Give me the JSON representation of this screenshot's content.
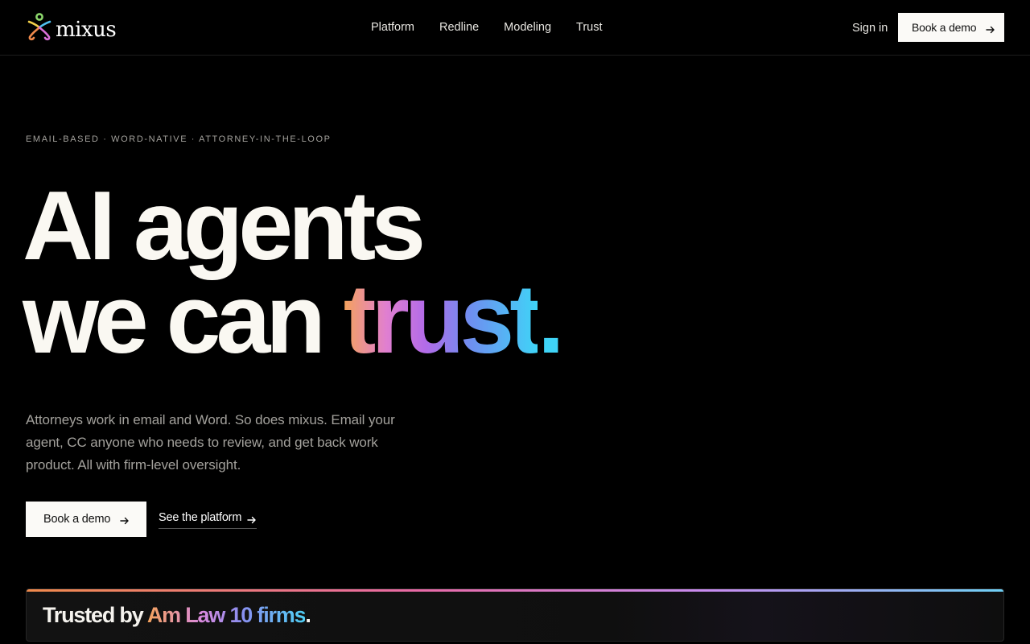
{
  "brand": {
    "name": "mixus"
  },
  "nav": {
    "items": [
      {
        "label": "Platform"
      },
      {
        "label": "Redline"
      },
      {
        "label": "Modeling"
      },
      {
        "label": "Trust"
      }
    ],
    "sign_in": "Sign in",
    "cta": "Book a demo"
  },
  "hero": {
    "eyebrow": "EMAIL-BASED · WORD-NATIVE · ATTORNEY-IN-THE-LOOP",
    "title_line1": "AI agents",
    "title_line2_prefix": "we can",
    "title_line2_highlight": "trust",
    "title_line2_suffix": ".",
    "subtitle": "Attorneys work in email and Word. So does mixus. Email your agent, CC anyone who needs to review, and get back work product. All with firm-level oversight.",
    "primary_cta": "Book a demo",
    "secondary_cta": "See the platform"
  },
  "trusted": {
    "prefix": "Trusted by",
    "highlight": "Am Law 10 firms",
    "suffix": "."
  },
  "icons": {
    "logo": "mixus-logo-icon",
    "arrow": "arrow-right-icon"
  },
  "colors": {
    "background": "#000000",
    "button_bg": "#fbfaf7",
    "gradient_start": "#f5a35c",
    "gradient_mid": "#b36be8",
    "gradient_end": "#3fd4f7"
  }
}
